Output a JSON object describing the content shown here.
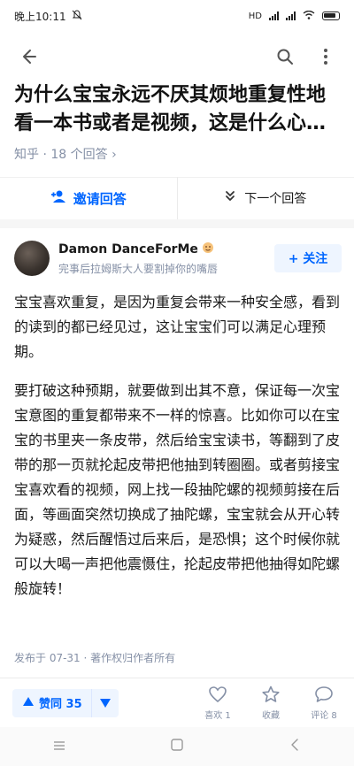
{
  "status_bar": {
    "time": "晚上10:11",
    "network": "HD",
    "battery_icon": "battery-icon"
  },
  "top_bar": {
    "back_icon": "back-arrow-icon",
    "search_icon": "search-icon",
    "more_icon": "more-vertical-icon"
  },
  "question": {
    "title": "为什么宝宝永远不厌其烦地重复性地看一本书或者是视频，这是什么心理…",
    "meta": "知乎 · 18 个回答 ›"
  },
  "actions": {
    "invite_label": "邀请回答",
    "next_label": "下一个回答"
  },
  "author": {
    "name": "Damon DanceForMe",
    "bio": "完事后拉姆斯大人要割掉你的嘴唇",
    "follow_label": "+ 关注"
  },
  "answer": {
    "paragraphs": [
      "宝宝喜欢重复，是因为重复会带来一种安全感，看到的读到的都已经见过，这让宝宝们可以满足心理预期。",
      "要打破这种预期，就要做到出其不意，保证每一次宝宝意图的重复都带来不一样的惊喜。比如你可以在宝宝的书里夹一条皮带，然后给宝宝读书，等翻到了皮带的那一页就抡起皮带把他抽到转圈圈。或者剪接宝宝喜欢看的视频，网上找一段抽陀螺的视频剪接在后面，等画面突然切换成了抽陀螺，宝宝就会从开心转为疑惑，然后醒悟过后来后，是恐惧；这个时候你就可以大喝一声把他震慑住，抡起皮带把他抽得如陀螺般旋转！"
    ],
    "publish_info": "发布于 07-31 · 著作权归作者所有"
  },
  "bottom_bar": {
    "vote_label": "赞同 35",
    "like_label": "喜欢 1",
    "collect_label": "收藏",
    "comment_label": "评论 8"
  },
  "colors": {
    "accent": "#0066ff",
    "accent_bg": "#eef5ff",
    "meta": "#8590a6"
  }
}
